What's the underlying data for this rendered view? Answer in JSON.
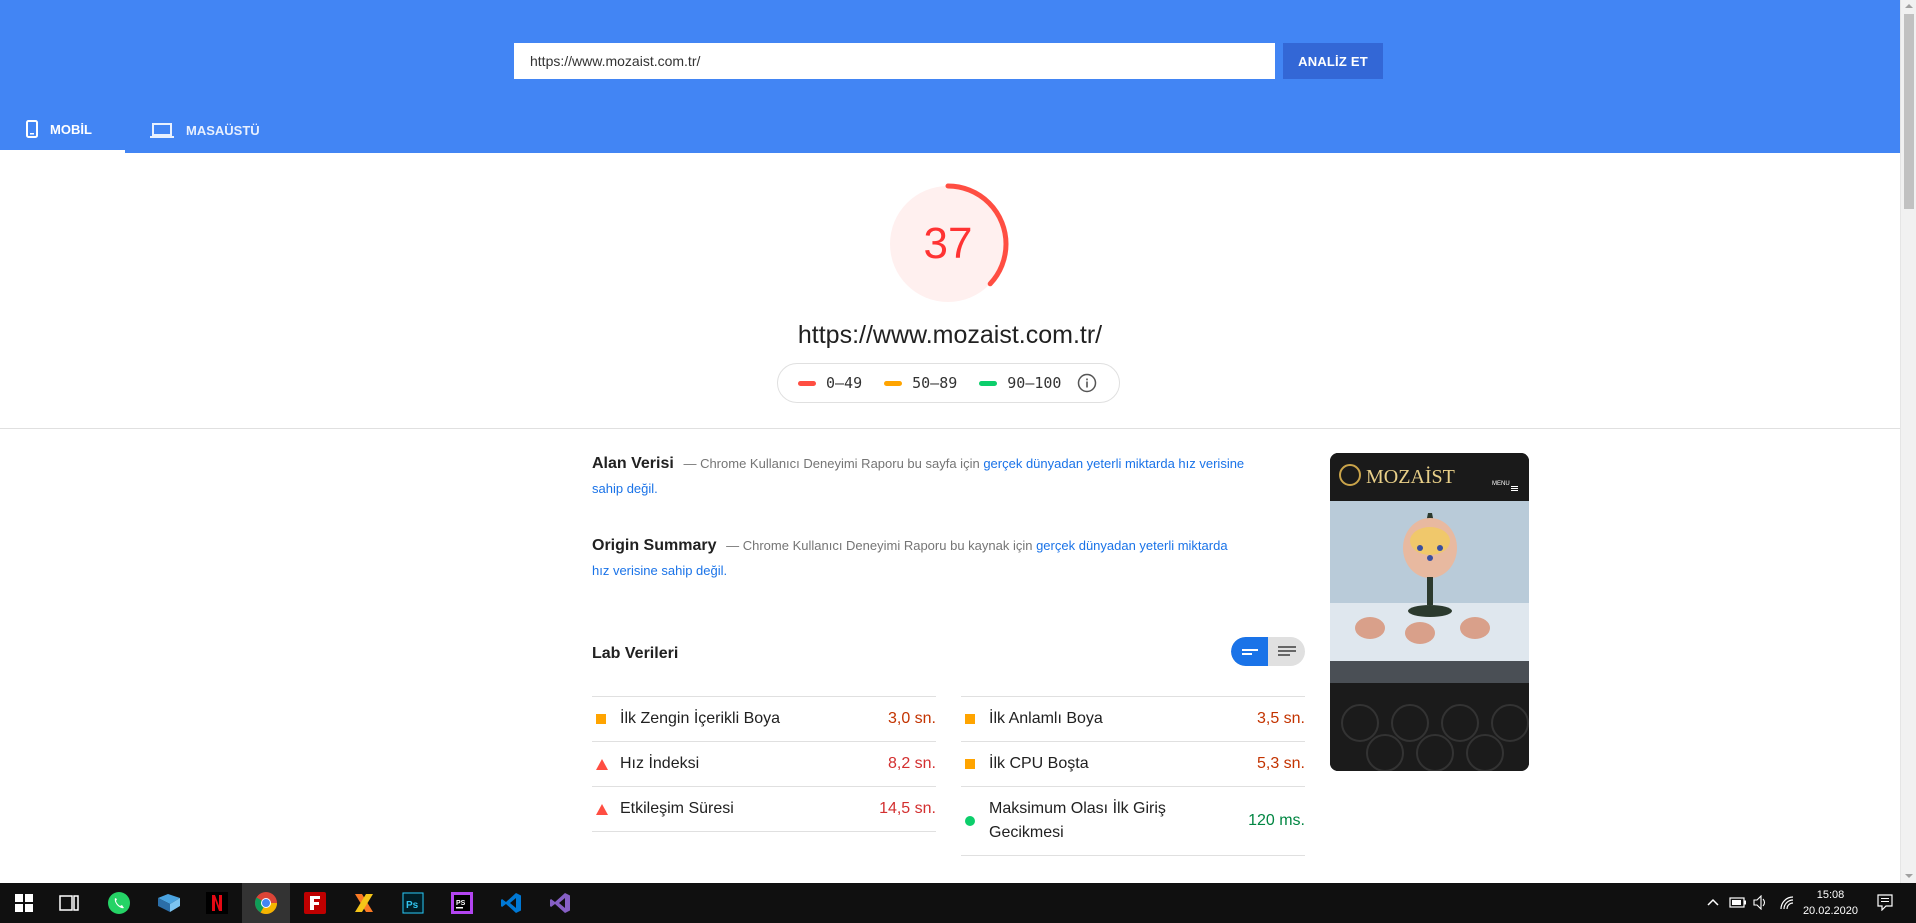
{
  "search": {
    "url_value": "https://www.mozaist.com.tr/",
    "analyze_label": "ANALİZ ET"
  },
  "tabs": [
    {
      "label": "MOBİL",
      "active": true
    },
    {
      "label": "MASAÜSTÜ",
      "active": false
    }
  ],
  "score": {
    "value": "37",
    "fraction": 0.37,
    "url": "https://www.mozaist.com.tr/"
  },
  "legend": [
    {
      "label": "0–49",
      "color": "#ff4e42"
    },
    {
      "label": "50–89",
      "color": "#ffa400"
    },
    {
      "label": "90–100",
      "color": "#0cce6b"
    }
  ],
  "field_data": {
    "title": "Alan Verisi",
    "text": "— Chrome Kullanıcı Deneyimi Raporu bu sayfa için ",
    "link": "gerçek dünyadan yeterli miktarda hız verisine sahip değil."
  },
  "origin_summary": {
    "title": "Origin Summary",
    "text": "— Chrome Kullanıcı Deneyimi Raporu bu kaynak için ",
    "link": "gerçek dünyadan yeterli miktarda hız verisine sahip değil."
  },
  "lab": {
    "title": "Lab Verileri",
    "metrics_left": [
      {
        "label": "İlk Zengin İçerikli Boya",
        "value": "3,0 sn.",
        "status": "average"
      },
      {
        "label": "Hız İndeksi",
        "value": "8,2 sn.",
        "status": "fail"
      },
      {
        "label": "Etkileşim Süresi",
        "value": "14,5 sn.",
        "status": "fail"
      }
    ],
    "metrics_right": [
      {
        "label": "İlk Anlamlı Boya",
        "value": "3,5 sn.",
        "status": "average"
      },
      {
        "label": "İlk CPU Boşta",
        "value": "5,3 sn.",
        "status": "average"
      },
      {
        "label": "Maksimum Olası İlk Giriş Gecikmesi",
        "value": "120 ms.",
        "status": "pass"
      }
    ]
  },
  "screenshot": {
    "logo_text": "MOZAİST",
    "menu_text": "MENU"
  },
  "taskbar": {
    "apps": [
      "start-icon",
      "task-view-icon",
      "whatsapp-icon",
      "folder-icon",
      "netflix-icon",
      "chrome-icon",
      "filezilla-icon",
      "xampp-icon",
      "photoshop-icon",
      "phpstorm-icon",
      "vscode-icon",
      "visual-studio-icon"
    ],
    "time": "15:08",
    "date": "20.02.2020"
  }
}
